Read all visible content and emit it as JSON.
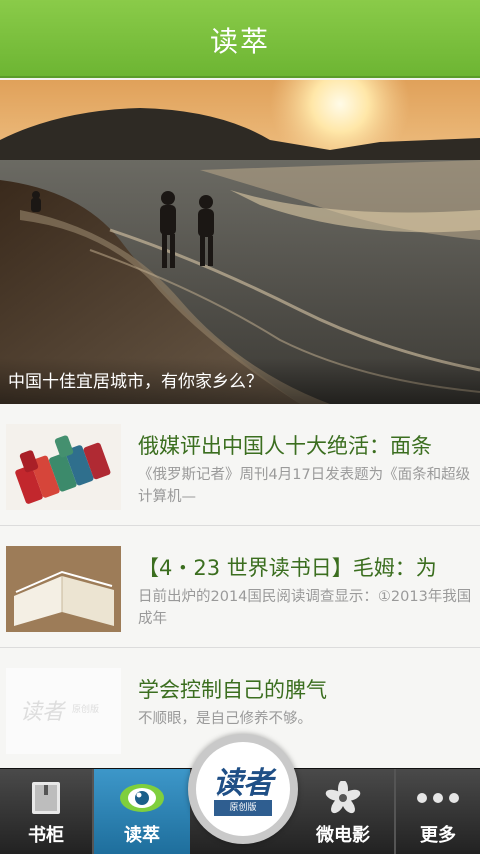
{
  "header": {
    "title": "读萃"
  },
  "hero": {
    "caption": "中国十佳宜居城市，有你家乡么？"
  },
  "articles": [
    {
      "title": "俄媒评出中国人十大绝活：面条",
      "desc": "《俄罗斯记者》周刊4月17日发表题为《面条和超级计算机—"
    },
    {
      "title": "【4・23 世界读书日】毛姆：为",
      "desc": "日前出炉的2014国民阅读调查显示：①2013年我国成年"
    },
    {
      "title": "学会控制自己的脾气",
      "desc": "不顺眼，是自己修养不够。"
    }
  ],
  "thumb3": {
    "logo_text": "读者",
    "sub_text": "原创版"
  },
  "nav": {
    "items": [
      {
        "label": "书柜",
        "icon": "bookshelf-icon"
      },
      {
        "label": "读萃",
        "icon": "eye-icon"
      },
      {
        "label": "微电影",
        "icon": "flower-icon"
      },
      {
        "label": "更多",
        "icon": "more-dots-icon"
      }
    ],
    "center": {
      "logo": "读者",
      "sub": "原创版"
    }
  },
  "colors": {
    "header_green": "#7cc043",
    "title_green": "#3b6e1f",
    "active_blue": "#2d86b8"
  }
}
